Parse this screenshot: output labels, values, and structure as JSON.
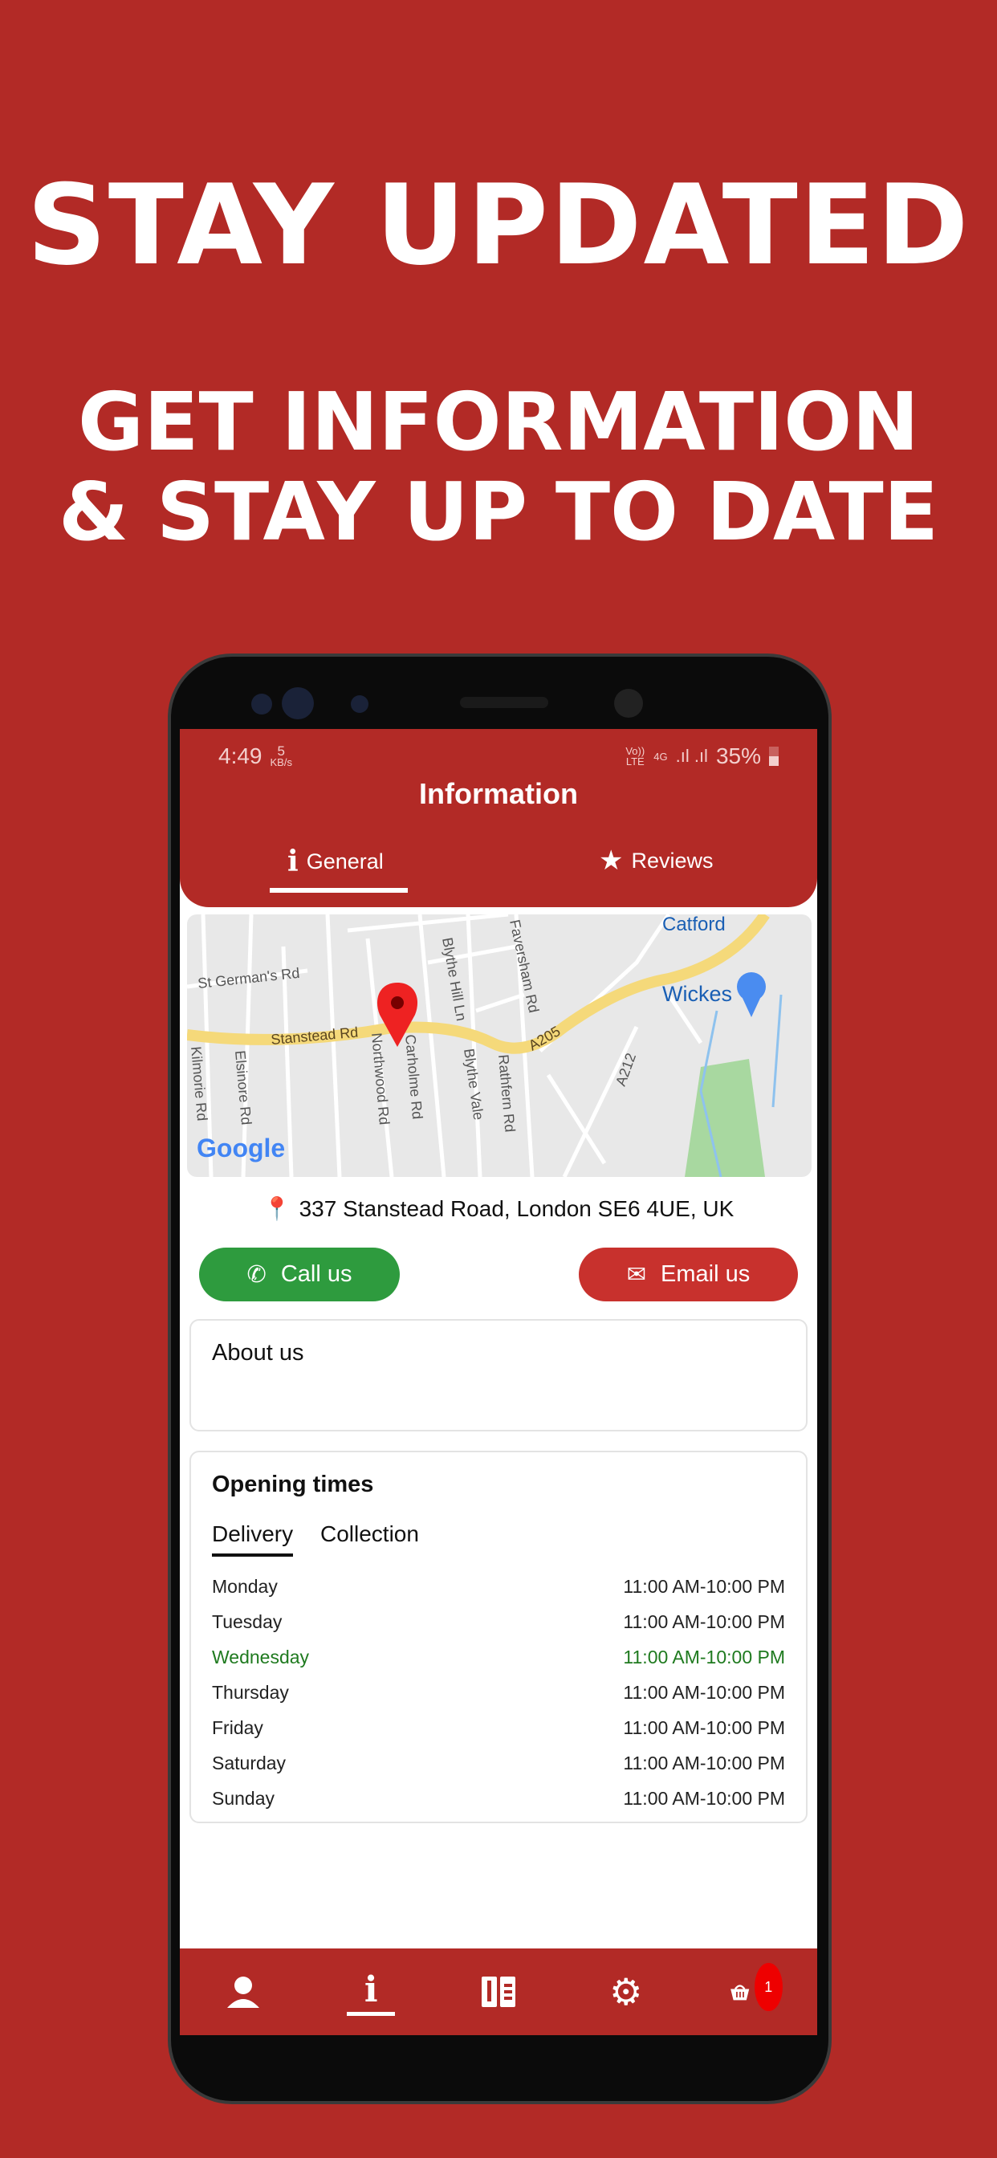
{
  "promo": {
    "headline": "STAY UPDATED",
    "subline1": "GET INFORMATION",
    "subline2": "& STAY UP TO DATE"
  },
  "status": {
    "time": "4:49",
    "speed_value": "5",
    "speed_unit": "KB/s",
    "volte": "Vo)) LTE",
    "network": "4G",
    "battery": "35%"
  },
  "header": {
    "title": "Information",
    "tabs": [
      {
        "label": "General",
        "icon": "info-icon",
        "active": true
      },
      {
        "label": "Reviews",
        "icon": "star-icon",
        "active": false
      }
    ]
  },
  "map": {
    "labels": [
      "St German's Rd",
      "Stanstead Rd",
      "A205",
      "Blythe Hill Ln",
      "Faversham Rd",
      "Kilmorie Rd",
      "Elsinore Rd",
      "Northwood Rd",
      "Carholme Rd",
      "Blythe Vale",
      "Rathfern Rd",
      "A212",
      "Catford",
      "Wickes"
    ],
    "attribution": "Google"
  },
  "address": "337 Stanstead Road, London SE6 4UE, UK",
  "actions": {
    "call": "Call us",
    "email": "Email us",
    "call_color": "#2e9b3e",
    "email_color": "#c8312d"
  },
  "about": {
    "title": "About us"
  },
  "opening": {
    "title": "Opening times",
    "tabs": [
      "Delivery",
      "Collection"
    ],
    "active_tab": "Delivery",
    "rows": [
      {
        "day": "Monday",
        "hours": "11:00 AM-10:00 PM"
      },
      {
        "day": "Tuesday",
        "hours": "11:00 AM-10:00 PM"
      },
      {
        "day": "Wednesday",
        "hours": "11:00 AM-10:00 PM",
        "today": true
      },
      {
        "day": "Thursday",
        "hours": "11:00 AM-10:00 PM"
      },
      {
        "day": "Friday",
        "hours": "11:00 AM-10:00 PM"
      },
      {
        "day": "Saturday",
        "hours": "11:00 AM-10:00 PM"
      },
      {
        "day": "Sunday",
        "hours": "11:00 AM-10:00 PM"
      }
    ]
  },
  "nav": {
    "items": [
      "user-icon",
      "info-icon",
      "menu-book-icon",
      "settings-icon",
      "basket-icon"
    ],
    "active": "info-icon",
    "basket_count": "1"
  },
  "colors": {
    "brand": "#b22a26",
    "today": "#1f7a1f"
  }
}
